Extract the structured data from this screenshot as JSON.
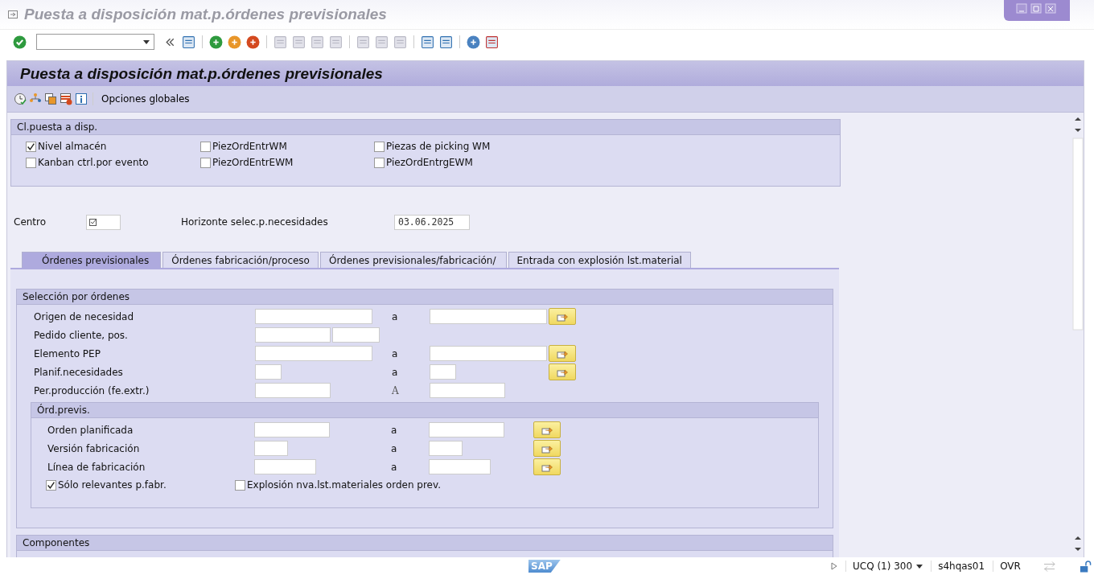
{
  "window": {
    "title": "Puesta a disposición mat.p.órdenes previsionales"
  },
  "screen_title": "Puesta a disposición mat.p.órdenes previsionales",
  "app_toolbar": {
    "button": "Opciones globales"
  },
  "picking_group": {
    "title": "Cl.puesta a disp.",
    "checkboxes": [
      {
        "label": "Nivel almacén",
        "checked": true
      },
      {
        "label": "PiezOrdEntrWM",
        "checked": false
      },
      {
        "label": "Piezas de picking WM",
        "checked": false
      },
      {
        "label": "Kanban ctrl.por evento",
        "checked": false
      },
      {
        "label": "PiezOrdEntrEWM",
        "checked": false
      },
      {
        "label": "PiezOrdEntrgEWM",
        "checked": false
      }
    ]
  },
  "plant": {
    "label": "Centro",
    "required": true
  },
  "horizon": {
    "label": "Horizonte selec.p.necesidades",
    "value": "03.06.2025"
  },
  "tabs": [
    {
      "label": "Órdenes previsionales",
      "selected": true
    },
    {
      "label": "Órdenes fabricación/proceso",
      "selected": false
    },
    {
      "label": "Órdenes previsionales/fabricación/",
      "selected": false
    },
    {
      "label": "Entrada con explosión lst.material",
      "selected": false
    }
  ],
  "order_selection": {
    "title": "Selección por órdenes",
    "rows": [
      {
        "kind": "range",
        "label": "Origen de necesidad",
        "separator": "a",
        "multiple_selection": true
      },
      {
        "kind": "pair",
        "label": "Pedido cliente, pos."
      },
      {
        "kind": "range",
        "label": "Elemento PEP",
        "separator": "a",
        "multiple_selection": true
      },
      {
        "kind": "range",
        "label": "Planif.necesidades",
        "separator": "a",
        "multiple_selection": true
      },
      {
        "kind": "range",
        "label": "Per.producción (fe.extr.)",
        "separator": "A",
        "multiple_selection": false
      }
    ]
  },
  "planned_orders": {
    "title": "Órd.previs.",
    "rows": [
      {
        "kind": "range",
        "label": "Orden planificada",
        "separator": "a",
        "multiple_selection": true
      },
      {
        "kind": "range",
        "label": "Versión fabricación",
        "separator": "a",
        "multiple_selection": true
      },
      {
        "kind": "range",
        "label": "Línea de fabricación",
        "separator": "a",
        "multiple_selection": true
      }
    ],
    "checkboxes": [
      {
        "label": "Sólo relevantes p.fabr.",
        "checked": true
      },
      {
        "label": "Explosión nva.lst.materiales orden prev.",
        "checked": false
      }
    ]
  },
  "components": {
    "title": "Componentes"
  },
  "status_bar": {
    "logo": "SAP",
    "system": "UCQ (1) 300",
    "server": "s4hqas01",
    "mode": "OVR"
  }
}
